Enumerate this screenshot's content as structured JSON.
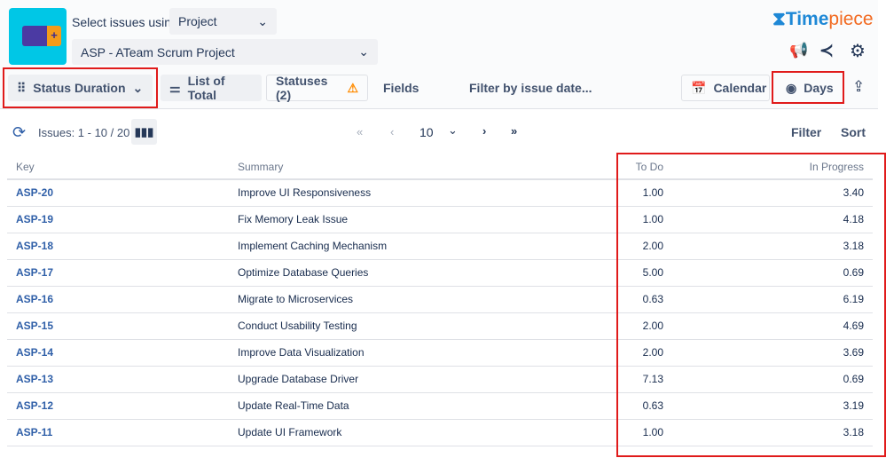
{
  "header": {
    "select_label": "Select issues using",
    "select_mode": "Project",
    "project": "ASP - ATeam Scrum Project",
    "brand_a": "Time",
    "brand_b": "piece"
  },
  "toolbar": {
    "report_type": "Status Duration",
    "list_of_total": "List of Total",
    "statuses": "Statuses (2)",
    "fields": "Fields",
    "filter_date": "Filter by issue date...",
    "calendar": "Calendar",
    "days": "Days"
  },
  "pager": {
    "issues": "Issues: 1 - 10 / 20",
    "page_size": "10",
    "filter": "Filter",
    "sort": "Sort"
  },
  "table": {
    "columns": [
      "Key",
      "Summary",
      "To Do",
      "In Progress"
    ],
    "rows": [
      [
        "ASP-20",
        "Improve UI Responsiveness",
        "1.00",
        "3.40"
      ],
      [
        "ASP-19",
        "Fix Memory Leak Issue",
        "1.00",
        "4.18"
      ],
      [
        "ASP-18",
        "Implement Caching Mechanism",
        "2.00",
        "3.18"
      ],
      [
        "ASP-17",
        "Optimize Database Queries",
        "5.00",
        "0.69"
      ],
      [
        "ASP-16",
        "Migrate to Microservices",
        "0.63",
        "6.19"
      ],
      [
        "ASP-15",
        "Conduct Usability Testing",
        "2.00",
        "4.69"
      ],
      [
        "ASP-14",
        "Improve Data Visualization",
        "2.00",
        "3.69"
      ],
      [
        "ASP-13",
        "Upgrade Database Driver",
        "7.13",
        "0.69"
      ],
      [
        "ASP-12",
        "Update Real-Time Data",
        "0.63",
        "3.19"
      ],
      [
        "ASP-11",
        "Update UI Framework",
        "1.00",
        "3.18"
      ]
    ]
  },
  "colors": {
    "accent": "#2f5fa8",
    "highlight": "#e01b1b",
    "brand_blue": "#1e88d6",
    "brand_orange": "#f26a21"
  }
}
